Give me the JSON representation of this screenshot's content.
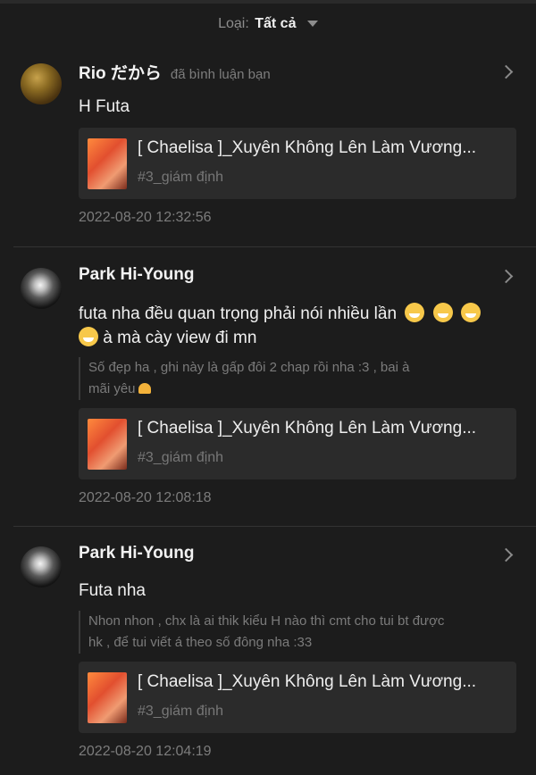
{
  "filter": {
    "label": "Loại:",
    "value": "Tất cả"
  },
  "notifications": [
    {
      "user": "Rio だから",
      "action": "đã bình luận bạn",
      "comment": "H Futa",
      "quote": "",
      "story_title": "[ Chaelisa ]_Xuyên Không Lên Làm Vương...",
      "chapter": "#3_giám định",
      "time": "2022-08-20 12:32:56"
    },
    {
      "user": "Park Hi-Young",
      "action": "",
      "comment_line1": "futa nha đều quan trọng phải nói nhiều lần",
      "comment_line2": "à mà cày view đi mn",
      "quote_line1": "Số đẹp ha , ghi này là gấp đôi 2 chap rồi nha :3 , bai à",
      "quote_line2": "mãi yêu",
      "story_title": "[ Chaelisa ]_Xuyên Không Lên Làm Vương...",
      "chapter": "#3_giám định",
      "time": "2022-08-20 12:08:18"
    },
    {
      "user": "Park Hi-Young",
      "action": "",
      "comment": "Futa nha",
      "quote_line1": "Nhon nhon , chx là ai thik kiểu H nào thì cmt cho tui bt được",
      "quote_line2": "hk , để tui viết á theo số đông nha :33",
      "story_title": "[ Chaelisa ]_Xuyên Không Lên Làm Vương...",
      "chapter": "#3_giám định",
      "time": "2022-08-20 12:04:19"
    }
  ],
  "icons": {
    "avatar1": "avatar-autumn",
    "avatar2": "avatar-moon",
    "chevron": "chevron-right-icon",
    "emoji": "grin-emoji",
    "heart": "heart-hands-emoji"
  },
  "colors": {
    "background": "#1c1c1c",
    "card": "#2b2b2b",
    "muted": "#7c7c7c"
  }
}
